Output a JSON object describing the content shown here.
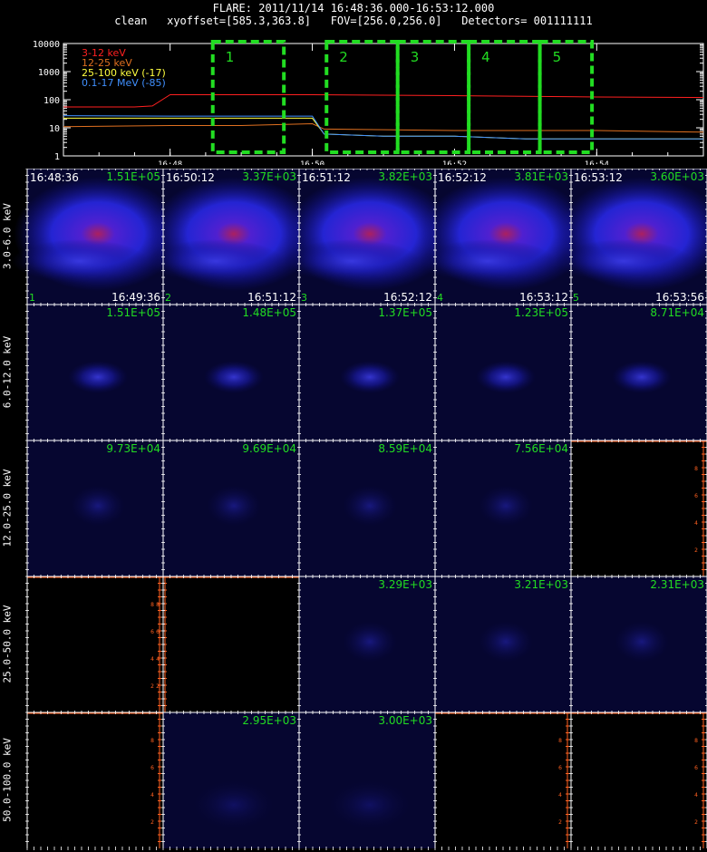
{
  "header": {
    "line1": "FLARE: 2011/11/14 16:48:36.000-16:53:12.000",
    "line2": "clean   xyoffset=[585.3,363.8]   FOV=[256.0,256.0]   Detectors= 001111111"
  },
  "lightcurve": {
    "legend": [
      {
        "label": "3-12 keV",
        "color": "#ff2020"
      },
      {
        "label": "12-25 keV",
        "color": "#e07020"
      },
      {
        "label": "25-100 keV (-17)",
        "color": "#ffff40"
      },
      {
        "label": "0.1-17 MeV (-85)",
        "color": "#4090ff"
      }
    ],
    "y_ticks": [
      "10000",
      "1000",
      "100",
      "10",
      "1"
    ],
    "x_ticks": [
      "16:48",
      "16:50",
      "16:52",
      "16:54"
    ],
    "interval_labels": [
      "1",
      "2",
      "3",
      "4",
      "5"
    ]
  },
  "chart_data": [
    {
      "type": "line",
      "title": "",
      "ylog": true,
      "ylim": [
        1,
        10000
      ],
      "xlim": [
        "16:46:30",
        "16:55:30"
      ],
      "series": [
        {
          "name": "3-12 keV",
          "x": [
            "16:46:30",
            "16:47:30",
            "16:47:45",
            "16:48:00",
            "16:50:00",
            "16:52:00",
            "16:54:00",
            "16:55:30"
          ],
          "y": [
            55,
            55,
            60,
            150,
            150,
            140,
            125,
            120
          ]
        },
        {
          "name": "12-25 keV",
          "x": [
            "16:46:30",
            "16:48:00",
            "16:49:00",
            "16:50:00",
            "16:50:10",
            "16:52:00",
            "16:54:00",
            "16:55:30"
          ],
          "y": [
            11,
            12,
            12,
            14,
            9,
            8,
            8,
            7
          ]
        },
        {
          "name": "25-100 keV (-17)",
          "x": [
            "16:46:30",
            "16:48:00",
            "16:50:00",
            "16:50:10",
            "16:51:00",
            "16:52:00",
            "16:53:00",
            "16:54:00",
            "16:55:30"
          ],
          "y": [
            22,
            22,
            22,
            6,
            5,
            5,
            4,
            4,
            4
          ]
        },
        {
          "name": "0.1-17 MeV (-85)",
          "x": [
            "16:46:30",
            "16:48:00",
            "16:50:00",
            "16:50:10",
            "16:51:00",
            "16:52:00",
            "16:53:00",
            "16:54:00",
            "16:55:30"
          ],
          "y": [
            27,
            26,
            26,
            6,
            5,
            5,
            4,
            4,
            4
          ]
        }
      ],
      "intervals": [
        {
          "label": "1",
          "start": "16:48:36",
          "end": "16:49:36"
        },
        {
          "label": "2",
          "start": "16:50:12",
          "end": "16:51:12"
        },
        {
          "label": "3",
          "start": "16:51:12",
          "end": "16:52:12"
        },
        {
          "label": "4",
          "start": "16:52:12",
          "end": "16:53:12"
        },
        {
          "label": "5",
          "start": "16:53:12",
          "end": "16:53:56"
        }
      ]
    },
    {
      "type": "heatmap",
      "rows": [
        "3.0-6.0 keV",
        "6.0-12.0 keV",
        "12.0-25.0 keV",
        "25.0-50.0 keV",
        "50.0-100.0 keV"
      ],
      "start_times": [
        "16:48:36",
        "16:50:12",
        "16:51:12",
        "16:52:12",
        "16:53:12"
      ],
      "end_times": [
        "16:49:36",
        "16:51:12",
        "16:52:12",
        "16:53:12",
        "16:53:56"
      ],
      "column_index_labels": [
        "1",
        "2",
        "3",
        "4",
        "5"
      ],
      "max_values": [
        [
          "1.51E+05",
          "3.37E+03",
          "3.82E+03",
          "3.81E+03",
          "3.60E+03"
        ],
        [
          "1.51E+05",
          "1.48E+05",
          "1.37E+05",
          "1.23E+05",
          "8.71E+04"
        ],
        [
          "9.73E+04",
          "9.69E+04",
          "8.59E+04",
          "7.56E+04",
          null
        ],
        [
          null,
          null,
          "3.29E+03",
          "3.21E+03",
          "2.31E+03"
        ],
        [
          null,
          "2.95E+03",
          "3.00E+03",
          null,
          null
        ]
      ],
      "empty_axis_ticks": [
        "2",
        "4",
        "6",
        "8"
      ]
    }
  ],
  "colors": {
    "background": "#000000",
    "panel_bg": "#060630",
    "grid_lines": "#ffffff",
    "interval_boxes": "#22dd22",
    "value_labels": "#22dd22",
    "empty_axes": "#ff6020"
  }
}
